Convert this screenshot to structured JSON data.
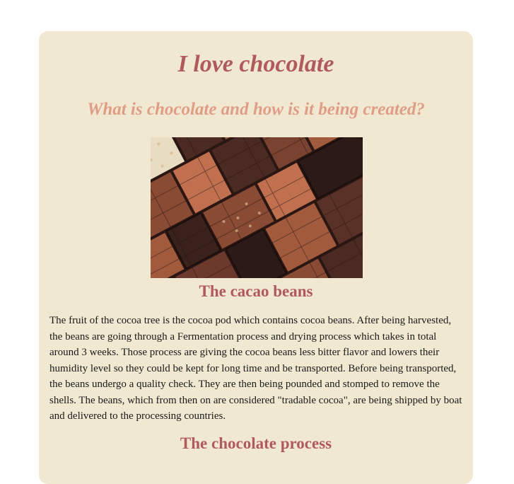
{
  "page": {
    "title": "I love chocolate",
    "subtitle": "What is chocolate and how is it being created?",
    "hero_image": {
      "description": "Assorted chocolate bars and tiles",
      "colors": [
        "#4a2a22",
        "#6b3a2c",
        "#8a4b34",
        "#a25a3d",
        "#c0704f",
        "#2c1a17",
        "#e8dcc2"
      ]
    },
    "sections": [
      {
        "heading": "The cacao beans",
        "body": "The fruit of the cocoa tree is the cocoa pod which contains cocoa beans. After being harvested, the beans are going through a Fermentation process and drying process which takes in total around 3 weeks. Those process are giving the cocoa beans less bitter flavor and lowers their humidity level so they could be kept for long time and be transported. Before being transported, the beans undergo a quality check. They are then being pounded and stomped to remove the shells. The beans, which from then on are considered \"tradable cocoa\", are being shipped by boat and delivered to the processing countries."
      },
      {
        "heading": "The chocolate process"
      }
    ]
  },
  "colors": {
    "card_bg": "#f1e8d2",
    "title": "#b05a5a",
    "subtitle": "#e09d86",
    "text": "#1a1a1a"
  }
}
